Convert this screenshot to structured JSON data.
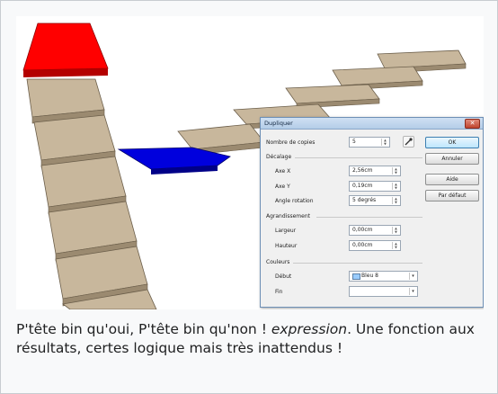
{
  "dialog": {
    "title": "Dupliquer",
    "close_glyph": "✕",
    "copies_label": "Nombre de copies",
    "copies_value": "5",
    "offset_section": "Décalage",
    "axis_x_label": "Axe X",
    "axis_x_value": "2,56cm",
    "axis_y_label": "Axe Y",
    "axis_y_value": "0,19cm",
    "angle_label": "Angle rotation",
    "angle_value": "5 degrés",
    "enlarge_section": "Agrandissement",
    "width_label": "Largeur",
    "width_value": "0,00cm",
    "height_label": "Hauteur",
    "height_value": "0,00cm",
    "colors_section": "Couleurs",
    "start_label": "Début",
    "start_value": "Bleu 8",
    "start_color": "#99ccff",
    "end_label": "Fin",
    "end_value": "",
    "buttons": {
      "ok": "OK",
      "cancel": "Annuler",
      "help": "Aide",
      "default": "Par défaut"
    }
  },
  "caption": {
    "part1": "P'tête bin qu'oui, P'tête bin qu'non ! ",
    "em": "expression",
    "part2": ". Une fonction aux résultats, certes logique mais très inattendus !"
  },
  "colors": {
    "step_top": "#c8b79c",
    "step_side": "#9b8a70",
    "red_top": "#ff0000",
    "blue_top": "#0000dd"
  }
}
